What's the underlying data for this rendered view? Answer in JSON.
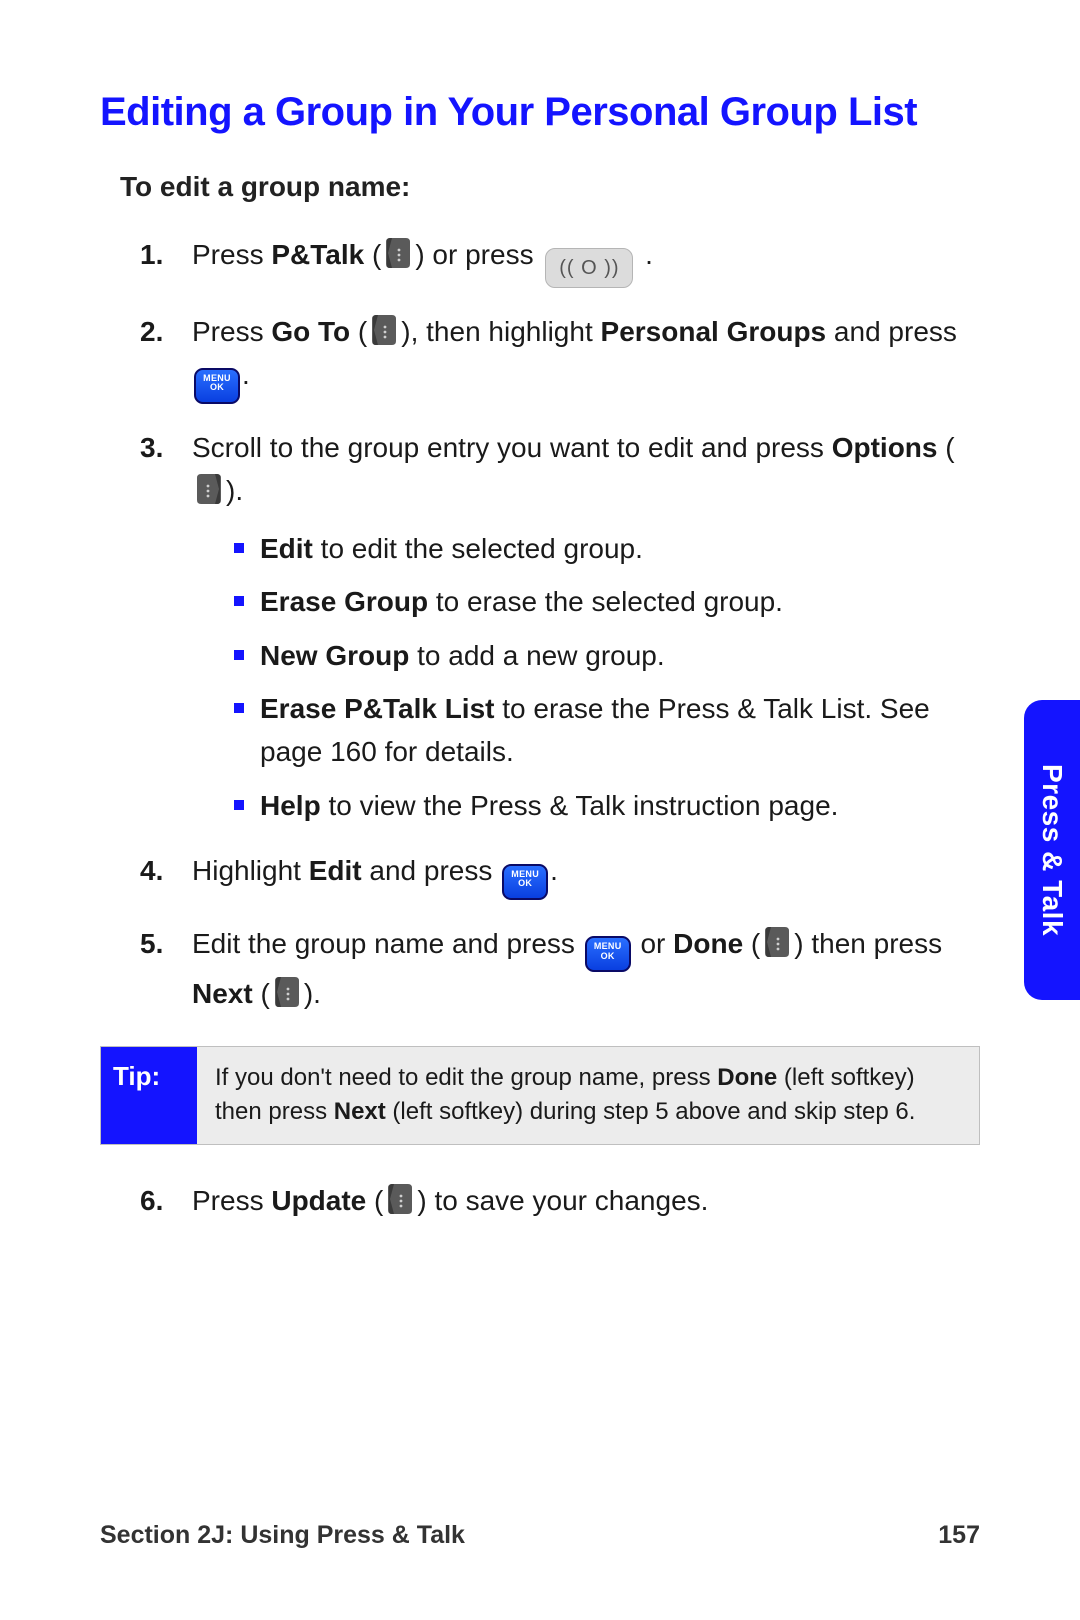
{
  "title": "Editing a Group in Your Personal Group List",
  "intro": "To edit a group name:",
  "steps": {
    "s1": {
      "a": "Press ",
      "b": "P&Talk",
      "c": " (",
      "d": ") or press ",
      "e": " ."
    },
    "s2": {
      "a": "Press ",
      "b": "Go To",
      "c": " (",
      "d": "), then highlight ",
      "e": "Personal Groups",
      "f": " and press ",
      "g": "."
    },
    "s3": {
      "a": "Scroll to the group entry you want to edit and press ",
      "b": "Options",
      "c": " (",
      "d": ").",
      "bullets": {
        "i1": {
          "b": "Edit",
          "t": " to edit the selected group."
        },
        "i2": {
          "b": "Erase Group",
          "t": " to erase the selected group."
        },
        "i3": {
          "b": "New Group",
          "t": " to add a new group."
        },
        "i4": {
          "b": "Erase P&Talk List",
          "t": " to erase the Press & Talk List. See page 160 for details."
        },
        "i5": {
          "b": "Help",
          "t": " to view the Press & Talk instruction page."
        }
      }
    },
    "s4": {
      "a": "Highlight ",
      "b": "Edit",
      "c": " and press ",
      "d": "."
    },
    "s5": {
      "a": "Edit the group name and press ",
      "b": " or ",
      "c": "Done",
      "d": " (",
      "e": ") then press ",
      "f": "Next",
      "g": " (",
      "h": ")."
    },
    "s6": {
      "a": "Press ",
      "b": "Update",
      "c": " (",
      "d": ") to save your changes."
    }
  },
  "tip": {
    "label": "Tip:",
    "t1": "If you don't need to edit the group name, press ",
    "b1": "Done",
    "t2": " (left softkey) then press ",
    "b2": "Next",
    "t3": " (left softkey) during step 5 above and skip step 6."
  },
  "sideTab": "Press & Talk",
  "footer": {
    "section": "Section 2J: Using Press & Talk",
    "page": "157"
  },
  "icons": {
    "pttPill": "(( O ))",
    "menuOkTop": "MENU",
    "menuOkBottom": "OK"
  }
}
